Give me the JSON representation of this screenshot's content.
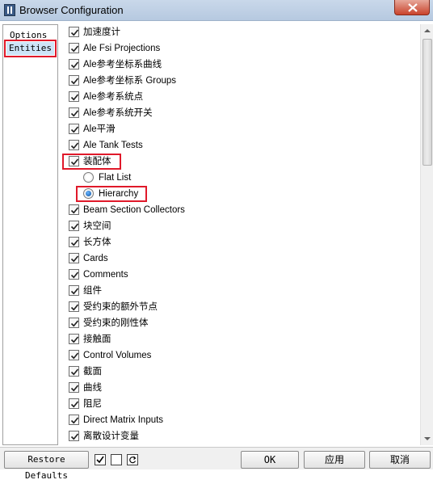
{
  "window": {
    "title": "Browser Configuration"
  },
  "nav": {
    "items": [
      {
        "label": "Options",
        "selected": false
      },
      {
        "label": "Entities",
        "selected": true
      }
    ]
  },
  "list": {
    "items": [
      {
        "kind": "checkbox",
        "label": "加速度计",
        "checked": true
      },
      {
        "kind": "checkbox",
        "label": "Ale Fsi Projections",
        "checked": true
      },
      {
        "kind": "checkbox",
        "label": "Ale参考坐标系曲线",
        "checked": true
      },
      {
        "kind": "checkbox",
        "label": "Ale参考坐标系 Groups",
        "checked": true
      },
      {
        "kind": "checkbox",
        "label": "Ale参考系统点",
        "checked": true
      },
      {
        "kind": "checkbox",
        "label": "Ale参考系统开关",
        "checked": true
      },
      {
        "kind": "checkbox",
        "label": "Ale平滑",
        "checked": true
      },
      {
        "kind": "checkbox",
        "label": "Ale Tank Tests",
        "checked": true
      },
      {
        "kind": "checkbox",
        "label": "装配体",
        "checked": true,
        "highlighted": true
      },
      {
        "kind": "radio",
        "label": "Flat List",
        "selected": false
      },
      {
        "kind": "radio",
        "label": "Hierarchy",
        "selected": true,
        "highlighted": true
      },
      {
        "kind": "checkbox",
        "label": "Beam Section Collectors",
        "checked": true
      },
      {
        "kind": "checkbox",
        "label": "块空间",
        "checked": true
      },
      {
        "kind": "checkbox",
        "label": "长方体",
        "checked": true
      },
      {
        "kind": "checkbox",
        "label": "Cards",
        "checked": true
      },
      {
        "kind": "checkbox",
        "label": "Comments",
        "checked": true
      },
      {
        "kind": "checkbox",
        "label": "组件",
        "checked": true
      },
      {
        "kind": "checkbox",
        "label": "受约束的额外节点",
        "checked": true
      },
      {
        "kind": "checkbox",
        "label": "受约束的刚性体",
        "checked": true
      },
      {
        "kind": "checkbox",
        "label": "接触面",
        "checked": true
      },
      {
        "kind": "checkbox",
        "label": "Control Volumes",
        "checked": true
      },
      {
        "kind": "checkbox",
        "label": "截面",
        "checked": true
      },
      {
        "kind": "checkbox",
        "label": "曲线",
        "checked": true
      },
      {
        "kind": "checkbox",
        "label": "阻尼",
        "checked": true
      },
      {
        "kind": "checkbox",
        "label": "Direct Matrix Inputs",
        "checked": true
      },
      {
        "kind": "checkbox",
        "label": "离散设计变量",
        "checked": true
      }
    ]
  },
  "buttons": {
    "restore": "Restore Defaults",
    "ok": "OK",
    "apply": "应用",
    "cancel": "取消"
  },
  "toolbar_icons": [
    "check-all-icon",
    "uncheck-all-icon",
    "refresh-icon"
  ],
  "colors": {
    "highlight": "#e0192a",
    "selection": "#cde4f7",
    "titlebar": "#c9d8ea",
    "close": "#c9432c"
  }
}
